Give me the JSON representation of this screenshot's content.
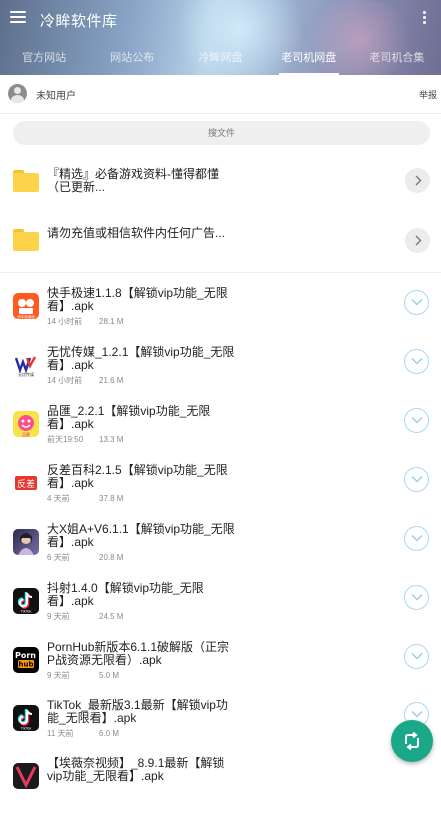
{
  "app": {
    "title": "冷眸软件库"
  },
  "tabs": [
    {
      "label": "官方网站"
    },
    {
      "label": "网站公布"
    },
    {
      "label": "冷眸网盘"
    },
    {
      "label": "老司机网盘"
    },
    {
      "label": "老司机合集"
    }
  ],
  "active_tab": "老司机网盘",
  "user": {
    "name": "未知用户",
    "report_label": "举报"
  },
  "search": {
    "placeholder": "搜文件"
  },
  "folders": [
    {
      "name": "『精选』必备游戏资料-懂得都懂（已更新...",
      "line1": "『精选』必备游戏资料-懂得都懂",
      "line2": "（已更新..."
    },
    {
      "name": "请勿充值或相信软件内任何广告..."
    }
  ],
  "files": [
    {
      "line1": "快手极速1.1.8【解锁vip功能_无限",
      "line2": "看】.apk",
      "time": "14 小时前",
      "size": "28.1 M",
      "icon": "kuaishou-app-icon"
    },
    {
      "line1": "无忧传媒_1.2.1【解锁vip功能_无限",
      "line2": "看】.apk",
      "time": "14 小时前",
      "size": "21.6 M",
      "icon": "wuyou-app-icon"
    },
    {
      "line1": "品匯_2.2.1【解锁vip功能_无限",
      "line2": "看】.apk",
      "time": "前天19:50",
      "size": "13.3 M",
      "icon": "pinhui-app-icon"
    },
    {
      "line1": "反差百科2.1.5【解锁vip功能_无限",
      "line2": "看】.apk",
      "time": "4 天前",
      "size": "37.8 M",
      "icon": "fancha-app-icon"
    },
    {
      "line1": "大X姐A+V6.1.1【解锁vip功能_无限",
      "line2": "看】.apk",
      "time": "6 天前",
      "size": "20.8 M",
      "icon": "dajie-app-icon"
    },
    {
      "line1": "抖射1.4.0【解锁vip功能_无限",
      "line2": "看】.apk",
      "time": "9 天前",
      "size": "24.5 M",
      "icon": "tiktok-app-icon"
    },
    {
      "line1": "PornHub新版本6.1.1破解版（正宗",
      "line2": "P战资源无限看）.apk",
      "time": "9 天前",
      "size": "5.0 M",
      "icon": "ph-app-icon"
    },
    {
      "line1": "TikTok_最新版3.1最新【解锁vip功",
      "line2": "能_无限看】.apk",
      "time": "11 天前",
      "size": "6.0 M",
      "icon": "tiktok-app-icon"
    },
    {
      "line1": "【埃薇奈视频】_8.9.1最新【解锁",
      "line2": "vip功能_无限看】.apk",
      "time": "",
      "size": "",
      "icon": "aiweinai-app-icon"
    }
  ],
  "icons": {
    "menu": "hamburger-menu-icon",
    "more": "more-vertical-icon",
    "folder": "folder-icon",
    "chevron": "chevron-right-icon",
    "download": "chevron-down-icon",
    "fab": "refresh-share-icon"
  },
  "colors": {
    "accent": "#1aa889",
    "folder": "#fcd34a",
    "download_ring": "#a9d8f2"
  }
}
